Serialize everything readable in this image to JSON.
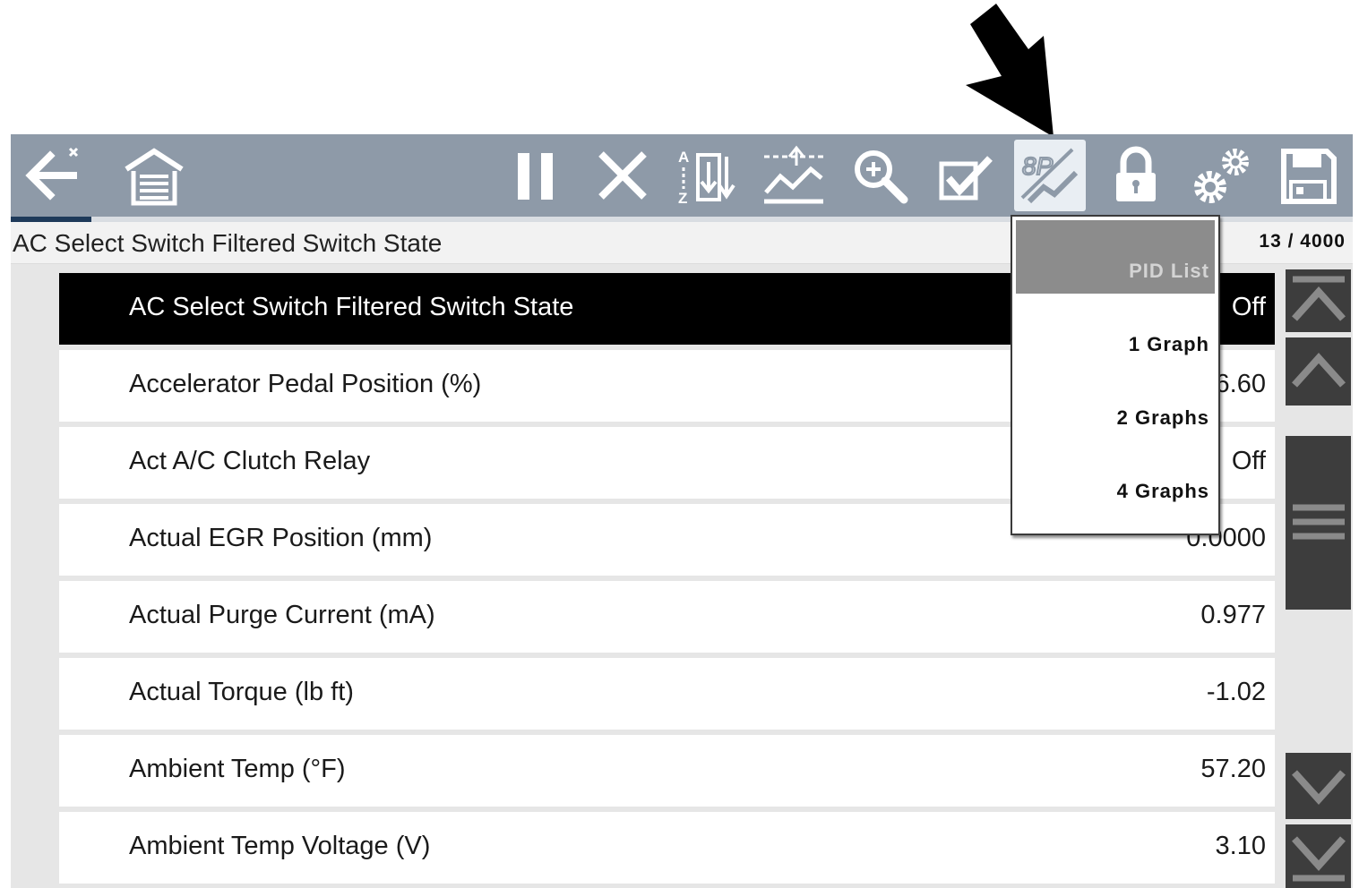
{
  "toolbar": {
    "icons": [
      "back-exit-icon",
      "home-garage-icon",
      "pause-icon",
      "clear-icon",
      "sort-icon",
      "triggers-icon",
      "zoom-icon",
      "custom-list-icon",
      "view-graph-icon",
      "lock-icon",
      "settings-icon",
      "save-icon"
    ],
    "active_icon": "view-graph-icon",
    "progress_fraction": 0.06
  },
  "subheader": {
    "title": "AC Select Switch Filtered Switch State",
    "page_counter": "13 / 4000"
  },
  "pid_list": [
    {
      "name": "AC Select Switch Filtered Switch State",
      "value": "Off",
      "selected": true
    },
    {
      "name": "Accelerator Pedal Position (%)",
      "value": "6.60",
      "selected": false
    },
    {
      "name": "Act A/C Clutch Relay",
      "value": "Off",
      "selected": false
    },
    {
      "name": "Actual EGR Position (mm)",
      "value": "0.0000",
      "selected": false
    },
    {
      "name": "Actual Purge Current (mA)",
      "value": "0.977",
      "selected": false
    },
    {
      "name": "Actual Torque (lb ft)",
      "value": "-1.02",
      "selected": false
    },
    {
      "name": "Ambient Temp (°F)",
      "value": "57.20",
      "selected": false
    },
    {
      "name": "Ambient Temp Voltage (V)",
      "value": "3.10",
      "selected": false
    }
  ],
  "view_menu": {
    "items": [
      "PID List",
      "1 Graph",
      "2 Graphs",
      "4 Graphs"
    ],
    "selected": "PID List"
  },
  "scrollbar": {
    "icons": [
      "first-page-icon",
      "page-up-icon",
      "drag-handle-icon",
      "page-down-icon",
      "last-page-icon"
    ]
  },
  "colors": {
    "toolbar_bg": "#8e9aa8",
    "selected_row_bg": "#000000",
    "menu_selected_bg": "#8c8c8c",
    "scroll_button_bg": "#3d3d3d"
  }
}
